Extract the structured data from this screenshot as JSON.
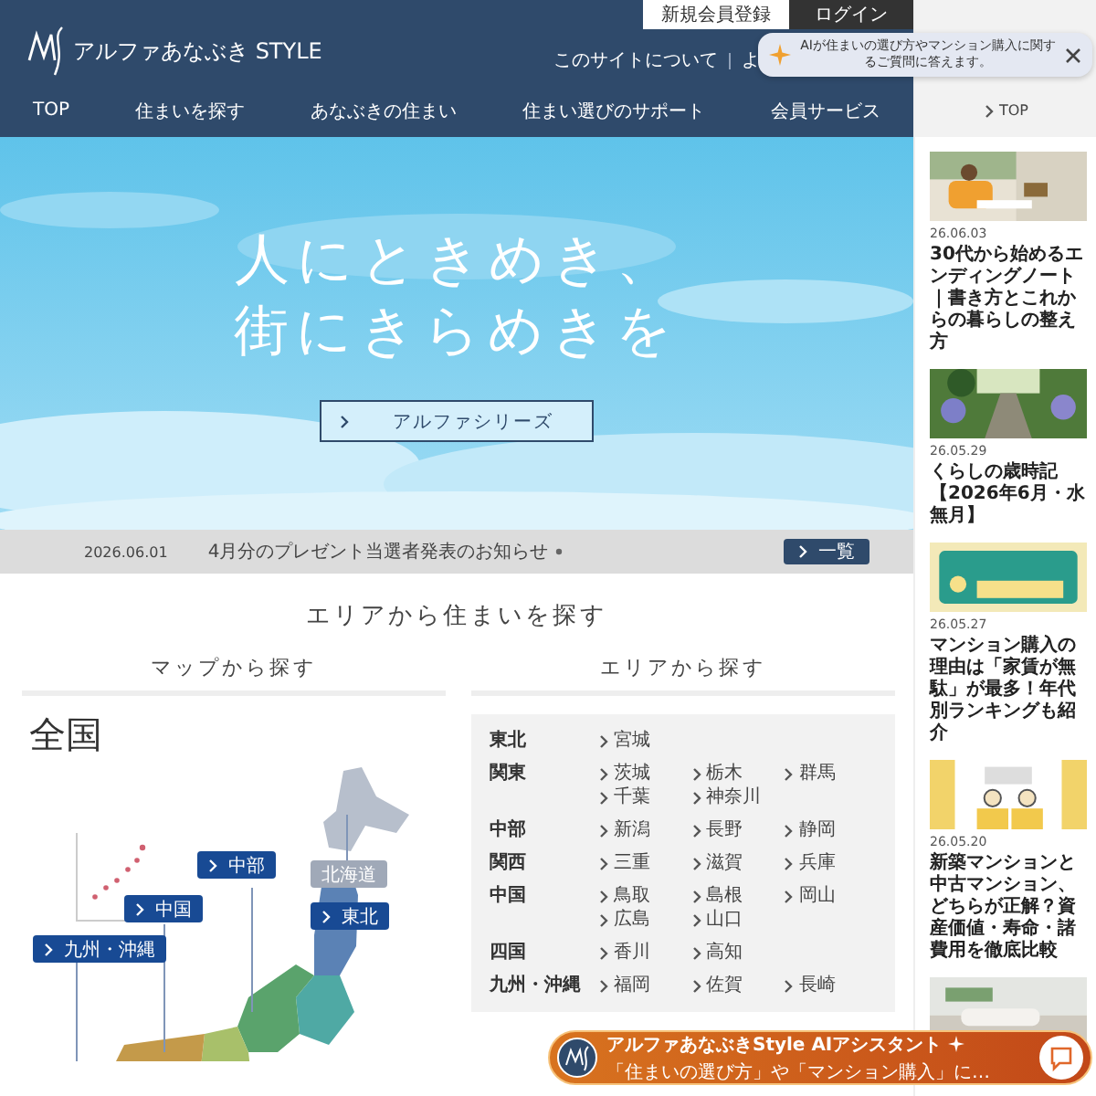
{
  "header": {
    "logo_text": "アルファあなぶき STYLE",
    "top_buttons": [
      {
        "label": "新規会員登録",
        "kind": "light"
      },
      {
        "label": "ログイン",
        "kind": "dark"
      }
    ],
    "utility_links": [
      "このサイトについて",
      "よ"
    ],
    "nav": [
      "TOP",
      "住まいを探す",
      "あなぶきの住まい",
      "住まい選びのサポート",
      "会員サービス"
    ]
  },
  "ai_tooltip": {
    "text": "AIが住まいの選び方やマンション購入に関するご質問に答えます。"
  },
  "hero": {
    "headline_lines": [
      "人にときめき、",
      "街にきらめきを"
    ],
    "button": "アルファシリーズ"
  },
  "news": {
    "date": "2026.06.01",
    "text": "4月分のプレゼント当選者発表のお知らせ",
    "button": "一覧"
  },
  "area_search": {
    "title": "エリアから住まいを探す",
    "map": {
      "title": "マップから探す",
      "heading": "全国",
      "regions": [
        {
          "label": "北海道",
          "disabled": true
        },
        {
          "label": "東北",
          "disabled": false
        },
        {
          "label": "中部",
          "disabled": false
        },
        {
          "label": "中国",
          "disabled": false
        },
        {
          "label": "九州・沖縄",
          "disabled": false
        }
      ]
    },
    "list": {
      "title": "エリアから探す",
      "rows": [
        {
          "region": "東北",
          "prefectures": [
            "宮城"
          ]
        },
        {
          "region": "関東",
          "prefectures": [
            "茨城",
            "栃木",
            "群馬",
            "千葉",
            "神奈川"
          ]
        },
        {
          "region": "中部",
          "prefectures": [
            "新潟",
            "長野",
            "静岡"
          ]
        },
        {
          "region": "関西",
          "prefectures": [
            "三重",
            "滋賀",
            "兵庫"
          ]
        },
        {
          "region": "中国",
          "prefectures": [
            "鳥取",
            "島根",
            "岡山",
            "広島",
            "山口"
          ]
        },
        {
          "region": "四国",
          "prefectures": [
            "香川",
            "高知"
          ]
        },
        {
          "region": "九州・沖縄",
          "prefectures": [
            "福岡",
            "佐賀",
            "長崎"
          ]
        }
      ]
    }
  },
  "sidebar": {
    "top_link": "TOP",
    "articles": [
      {
        "date": "26.06.03",
        "title": "30代から始めるエンディングノート｜書き方とこれからの暮らしの整え方"
      },
      {
        "date": "26.05.29",
        "title": "くらしの歳時記【2026年6月・水無月】"
      },
      {
        "date": "26.05.27",
        "title": "マンション購入の理由は「家賃が無駄」が最多！年代別ランキングも紹介"
      },
      {
        "date": "26.05.20",
        "title": "新築マンションと中古マンション、どちらが正解？資産価値・寿命・諸費用を徹底比較"
      }
    ]
  },
  "ai_chat": {
    "title": "アルファあなぶきStyle AIアシスタント",
    "subtitle": "「住まいの選び方」や「マンション購入」に…"
  }
}
